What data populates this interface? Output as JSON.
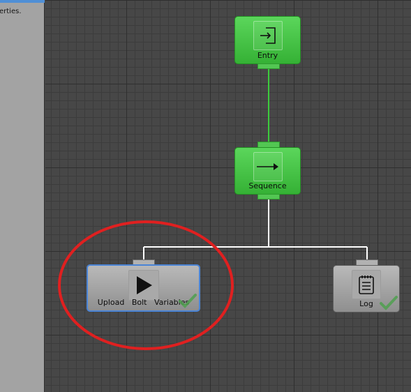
{
  "sidebar": {
    "text": "erties."
  },
  "nodes": {
    "entry": {
      "label": "Entry",
      "icon": "entry-icon"
    },
    "sequence": {
      "label": "Sequence",
      "icon": "arrow-right-icon"
    },
    "upload": {
      "label": "Upload   Bolt   Variables",
      "icon": "play-icon",
      "status": "success"
    },
    "log": {
      "label": "Log",
      "icon": "notepad-icon",
      "status": "success"
    }
  },
  "colors": {
    "node_green": "#46c446",
    "node_gray": "#a4a4a4",
    "selection": "#4a84d6",
    "annotation": "#e02020",
    "wire_green": "#3ccc3c",
    "wire_white": "#ffffff"
  }
}
